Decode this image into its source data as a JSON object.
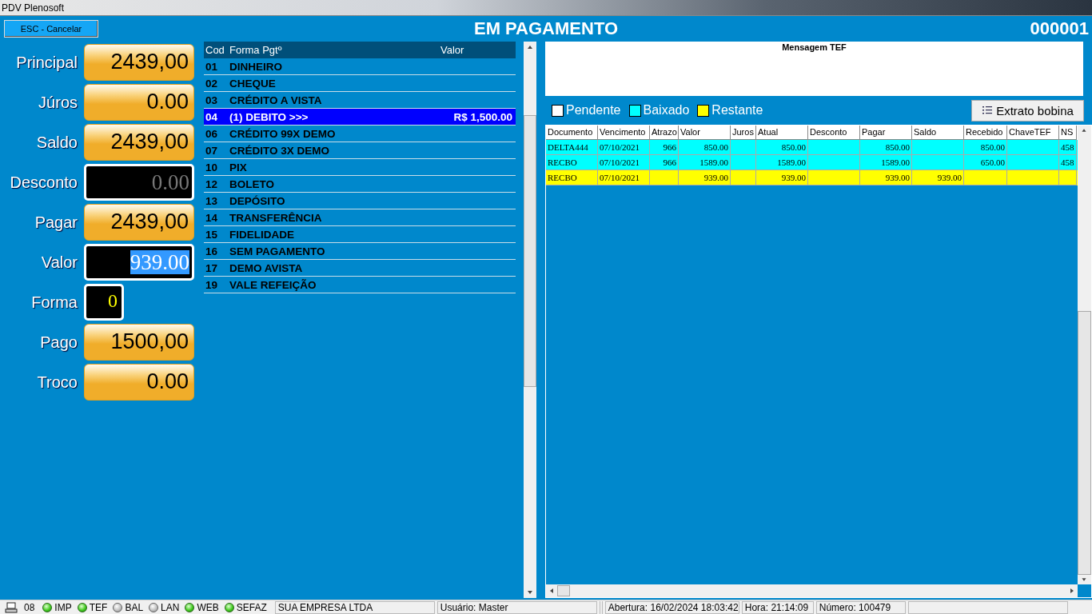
{
  "window": {
    "title": "PDV Plenosoft"
  },
  "cancel_button": "ESC - Cancelar",
  "screen_title": "EM PAGAMENTO",
  "sale_number": "000001",
  "fields": [
    {
      "label": "Principal",
      "value": "2439,00",
      "kind": "amount"
    },
    {
      "label": "Júros",
      "value": "0.00",
      "kind": "amount"
    },
    {
      "label": "Saldo",
      "value": "2439,00",
      "kind": "amount"
    },
    {
      "label": "Desconto",
      "value": "0.00",
      "kind": "input",
      "disabled": true,
      "selected": false
    },
    {
      "label": "Pagar",
      "value": "2439,00",
      "kind": "amount"
    },
    {
      "label": "Valor",
      "value": "939.00",
      "kind": "input",
      "disabled": false,
      "selected": true
    },
    {
      "label": "Forma",
      "value": "0",
      "kind": "code"
    },
    {
      "label": "Pago",
      "value": "1500,00",
      "kind": "amount"
    },
    {
      "label": "Troco",
      "value": "0.00",
      "kind": "amount"
    }
  ],
  "payment_list": {
    "columns": [
      "Cod",
      "Forma Pgtº",
      "Valor"
    ],
    "rows": [
      {
        "code": "01",
        "name": "DINHEIRO",
        "selected": false
      },
      {
        "code": "02",
        "name": "CHEQUE",
        "selected": false
      },
      {
        "code": "03",
        "name": "CRÉDITO A VISTA",
        "selected": false
      },
      {
        "code": "04",
        "name": "(1) DEBITO >>>",
        "value": "R$ 1,500.00",
        "selected": true
      },
      {
        "code": "06",
        "name": "CRÉDITO 99X DEMO",
        "selected": false
      },
      {
        "code": "07",
        "name": "CRÉDITO 3X DEMO",
        "selected": false
      },
      {
        "code": "10",
        "name": "PIX",
        "selected": false
      },
      {
        "code": "12",
        "name": "BOLETO",
        "selected": false
      },
      {
        "code": "13",
        "name": "DEPÓSITO",
        "selected": false
      },
      {
        "code": "14",
        "name": "TRANSFERÊNCIA",
        "selected": false
      },
      {
        "code": "15",
        "name": "FIDELIDADE",
        "selected": false
      },
      {
        "code": "16",
        "name": "SEM PAGAMENTO",
        "selected": false
      },
      {
        "code": "17",
        "name": "DEMO AVISTA",
        "selected": false
      },
      {
        "code": "19",
        "name": "VALE REFEIÇÃO",
        "selected": false
      }
    ]
  },
  "tef_message": {
    "title": "Mensagem TEF"
  },
  "legend": [
    {
      "label": "Pendente",
      "color": "#ffffff"
    },
    {
      "label": "Baixado",
      "color": "#00ffff"
    },
    {
      "label": "Restante",
      "color": "#ffff00"
    }
  ],
  "statement_button": "Extrato bobina",
  "table": {
    "columns": [
      "Documento",
      "Vencimento",
      "Atrazo",
      "Valor",
      "Juros",
      "Atual",
      "Desconto",
      "Pagar",
      "Saldo",
      "Recebido",
      "ChaveTEF",
      "NS"
    ],
    "rows": [
      {
        "color": "#00ffff",
        "cells": [
          "DELTA444",
          "07/10/2021",
          "966",
          "850.00",
          "",
          "850.00",
          "",
          "850.00",
          "",
          "850.00",
          "",
          "458"
        ]
      },
      {
        "color": "#00ffff",
        "cells": [
          "RECBO",
          "07/10/2021",
          "966",
          "1589.00",
          "",
          "1589.00",
          "",
          "1589.00",
          "",
          "650.00",
          "",
          "458"
        ]
      },
      {
        "color": "#ffff00",
        "cells": [
          "RECBO",
          "07/10/2021",
          "",
          "939.00",
          "",
          "939.00",
          "",
          "939.00",
          "939.00",
          "",
          "",
          ""
        ]
      }
    ]
  },
  "status_bar": {
    "terminal": "08",
    "indicators": [
      {
        "label": "IMP",
        "on": true
      },
      {
        "label": "TEF",
        "on": true
      },
      {
        "label": "BAL",
        "on": false
      },
      {
        "label": "LAN",
        "on": false
      },
      {
        "label": "WEB",
        "on": true
      },
      {
        "label": "SEFAZ",
        "on": true
      }
    ],
    "panels": [
      "SUA EMPRESA LTDA",
      "Usuário: Master",
      "Abertura: 16/02/2024 18:03:42",
      "Hora: 21:14:09",
      "Número: 100479"
    ]
  }
}
